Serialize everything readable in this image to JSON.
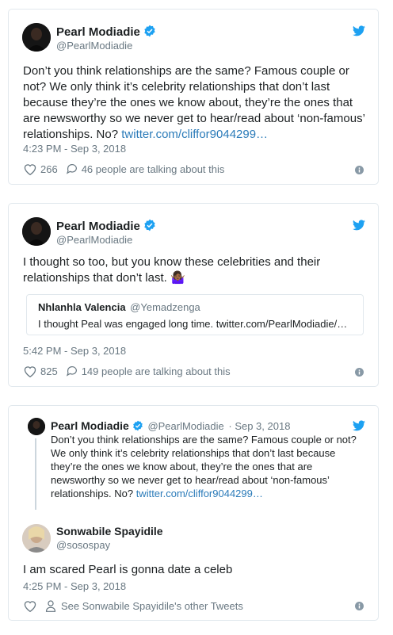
{
  "colors": {
    "link": "#2b7bb9",
    "muted": "#697882",
    "border": "#e1e8ed",
    "heart": "#697882",
    "twitter_blue": "#1da1f2"
  },
  "tweet1": {
    "name": "Pearl Modiadie",
    "handle": "@PearlModiadie",
    "text": "Don’t you think relationships are the same? Famous couple or not? We only think it’s celebrity relationships that don’t last because they’re the ones we know about, they’re the ones that are newsworthy so we never get to hear/read about ‘non-famous’ relationships. No?",
    "link": "twitter.com/cliffor9044299…",
    "time": "4:23 PM - Sep 3, 2018",
    "likes": "266",
    "replies": "46 people are talking about this"
  },
  "tweet2": {
    "name": "Pearl Modiadie",
    "handle": "@PearlModiadie",
    "text": "I thought so too, but you know these celebrities and their relationships that don’t last.",
    "emoji": "🤷🏾‍♀️",
    "quote": {
      "name": "Nhlanhla Valencia",
      "handle": "@Yemadzenga",
      "text": "I thought Peal was engaged long time. twitter.com/PearlModiadie/…"
    },
    "time": "5:42 PM - Sep 3, 2018",
    "likes": "825",
    "replies": "149 people are talking about this"
  },
  "tweet3": {
    "parent": {
      "name": "Pearl Modiadie",
      "handle": "@PearlModiadie",
      "date": "· Sep 3, 2018",
      "text": "Don’t you think relationships are the same? Famous couple or not? We only think it’s celebrity relationships that don’t last because they’re the ones we know about, they’re the ones that are newsworthy so we never get to hear/read about ‘non-famous’ relationships. No?",
      "link": "twitter.com/cliffor9044299…"
    },
    "name": "Sonwabile Spayidile",
    "handle": "@sosospay",
    "text": "I am scared Pearl is gonna date a celeb",
    "time": "4:25 PM - Sep 3, 2018",
    "other": "See Sonwabile Spayidile's other Tweets"
  },
  "icons": {
    "verified": "verified-badge-icon",
    "bird": "twitter-bird-icon",
    "heart": "heart-icon",
    "reply": "reply-bubble-icon",
    "info": "info-icon",
    "person": "person-icon"
  }
}
